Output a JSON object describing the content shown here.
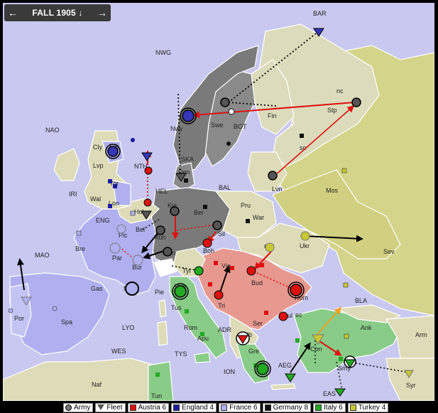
{
  "phase": {
    "prev_icon": "arrow-left-icon",
    "label": "FALL 1905 ↓",
    "next_icon": "arrow-right-icon"
  },
  "colors": {
    "sea": "#c8c8f0",
    "neutral_land": "#dedcb8",
    "austria": "#e8998f",
    "england": "#3636b8",
    "france": "#b0b0f0",
    "germany": "#787878",
    "italy": "#88cc88",
    "turkey": "#d4d488",
    "russia_land": "#d8d88a",
    "order_red": "#e01010",
    "order_black": "#000000",
    "order_orange": "#f0a020"
  },
  "sea_labels": [
    "BAR",
    "NWG",
    "NAO",
    "IRI",
    "NTH",
    "SKA",
    "HEL",
    "BOT",
    "BAL",
    "ENG",
    "MAO",
    "LYO",
    "WES",
    "TYS",
    "ION",
    "ADR",
    "AEG",
    "EAS",
    "BLA"
  ],
  "land_labels": [
    "nc",
    "Stp",
    "Fin",
    "Swe",
    "Nwy",
    "Cly",
    "Edi",
    "Lvp",
    "Yor",
    "Wal",
    "Lon",
    "Den",
    "Kie",
    "Ber",
    "Pru",
    "War",
    "Lvn",
    "Mos",
    "Ukr",
    "Sev",
    "sc",
    "Hol",
    "Bel",
    "Ruh",
    "Sil",
    "Mun",
    "Boh",
    "Gal",
    "Pic",
    "Bre",
    "Par",
    "Bur",
    "Tyr",
    "Vie",
    "Bud",
    "Gas",
    "Mar",
    "Pie",
    "Ven",
    "Tri",
    "Rum",
    "Ser",
    "Bul",
    "ec",
    "Spa",
    "Por",
    "Tus",
    "Rom",
    "Apu",
    "Alb",
    "Gre",
    "Con",
    "Ank",
    "Arm",
    "Smy",
    "Syr",
    "Naf",
    "Tun"
  ],
  "legend": [
    {
      "label": "Army",
      "icon": "army-circle-icon"
    },
    {
      "label": "Fleet",
      "icon": "fleet-triangle-icon"
    },
    {
      "label": "Austria 6",
      "color": "#e01010"
    },
    {
      "label": "England 4",
      "color": "#1a1aa0"
    },
    {
      "label": "France 6",
      "color": "#b0b0f0"
    },
    {
      "label": "Germany 8",
      "color": "#111111"
    },
    {
      "label": "Italy 6",
      "color": "#22aa22"
    },
    {
      "label": "Turkey 4",
      "color": "#c8c832"
    }
  ]
}
